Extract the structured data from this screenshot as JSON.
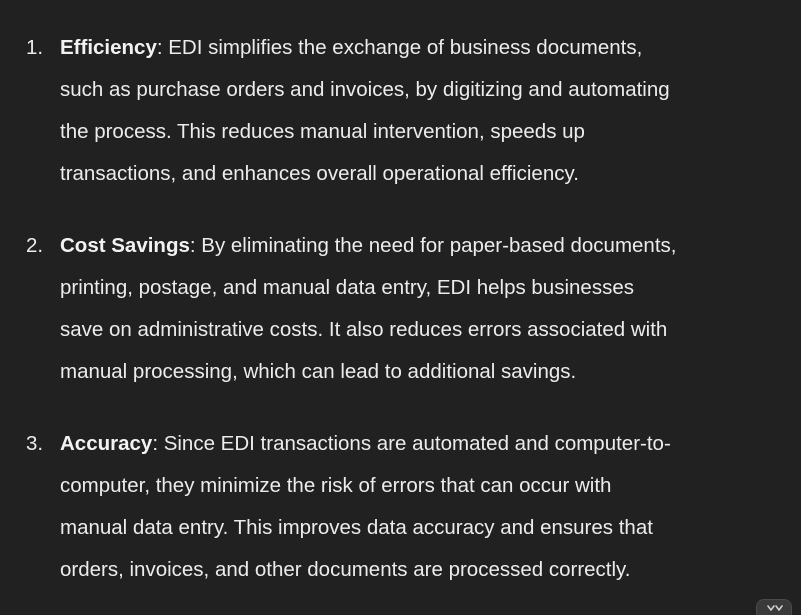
{
  "items": [
    {
      "number": "1.",
      "term": "Efficiency",
      "lines": [
        ": EDI simplifies the exchange of business documents,",
        "such as purchase orders and invoices, by digitizing and automating",
        "the process. This reduces manual intervention, speeds up",
        "transactions, and enhances overall operational efficiency."
      ]
    },
    {
      "number": "2.",
      "term": "Cost Savings",
      "lines": [
        ": By eliminating the need for paper-based documents,",
        "printing, postage, and manual data entry, EDI helps businesses",
        "save on administrative costs. It also reduces errors associated with",
        "manual processing, which can lead to additional savings."
      ]
    },
    {
      "number": "3.",
      "term": "Accuracy",
      "lines": [
        ": Since EDI transactions are automated and computer-to-",
        "computer, they minimize the risk of errors that can occur with",
        "manual data entry. This improves data accuracy and ensures that",
        "orders, invoices, and other documents are processed correctly."
      ]
    }
  ],
  "scroll_button": {
    "icon": "chevrons-icon"
  }
}
